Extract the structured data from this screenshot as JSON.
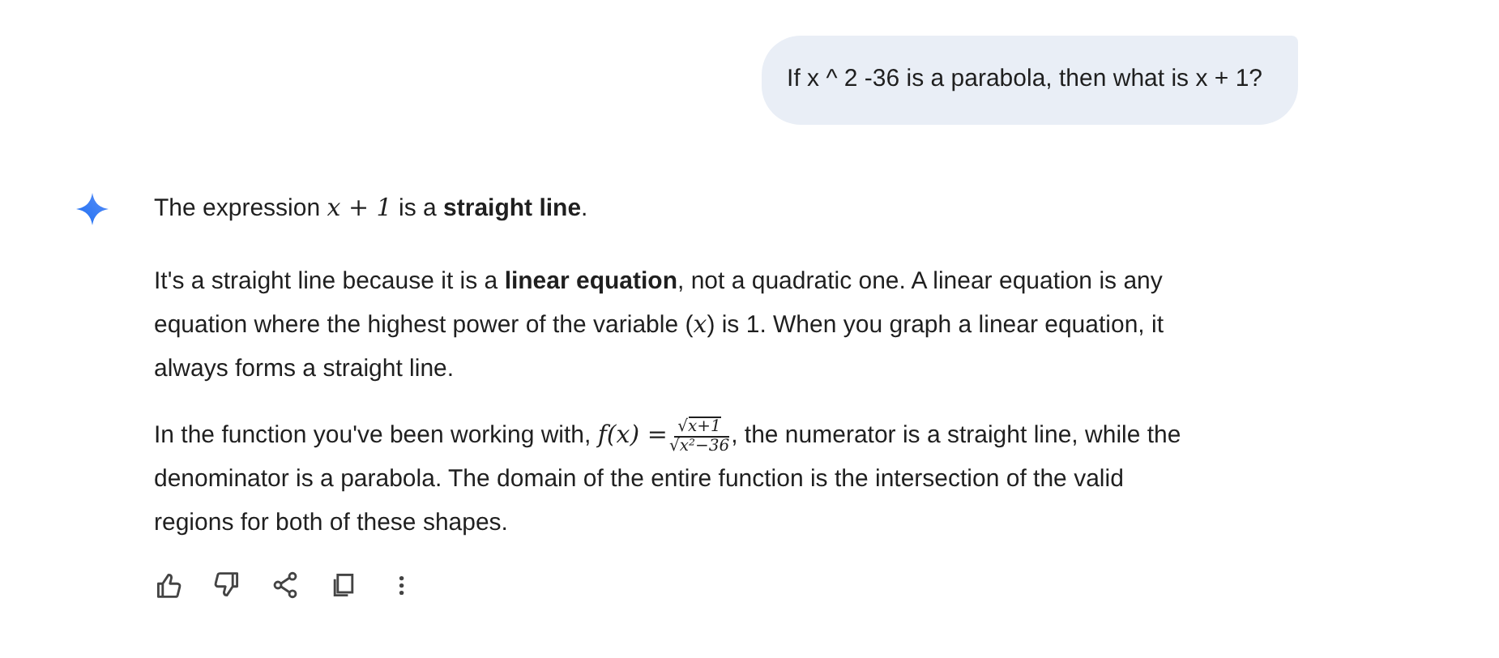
{
  "user_message": {
    "text": "If x ^ 2 -36 is a parabola, then what is x + 1?"
  },
  "response": {
    "paragraphs": [
      [
        {
          "kind": "text",
          "text": "The expression "
        },
        {
          "kind": "math",
          "text": "x + 1"
        },
        {
          "kind": "text",
          "text": " is a "
        },
        {
          "kind": "bold",
          "text": "straight line"
        },
        {
          "kind": "text",
          "text": "."
        }
      ],
      [
        {
          "kind": "text",
          "text": "It's a straight line because it is a "
        },
        {
          "kind": "bold",
          "text": "linear equation"
        },
        {
          "kind": "text",
          "text": ", not a quadratic one. A linear equation is any equation where the highest power of the variable ("
        },
        {
          "kind": "math",
          "text": "x"
        },
        {
          "kind": "text",
          "text": ") is 1. When you graph a linear equation, it always forms a straight line."
        }
      ],
      [
        {
          "kind": "text",
          "text": "In the function you've been working with, "
        },
        {
          "kind": "math",
          "text": "f(x) ="
        },
        {
          "kind": "fraction",
          "numerator": {
            "sign": "√",
            "body": "x+1"
          },
          "denominator": {
            "sign": "√",
            "body": "x²−36"
          }
        },
        {
          "kind": "text",
          "text": ", the numerator is a straight line, while the denominator is a parabola. The domain of the entire function is the intersection of the valid regions for both of these shapes."
        }
      ]
    ]
  },
  "actions": [
    {
      "kind": "thumbs-up"
    },
    {
      "kind": "thumbs-down"
    },
    {
      "kind": "share"
    },
    {
      "kind": "copy"
    },
    {
      "kind": "more"
    }
  ]
}
